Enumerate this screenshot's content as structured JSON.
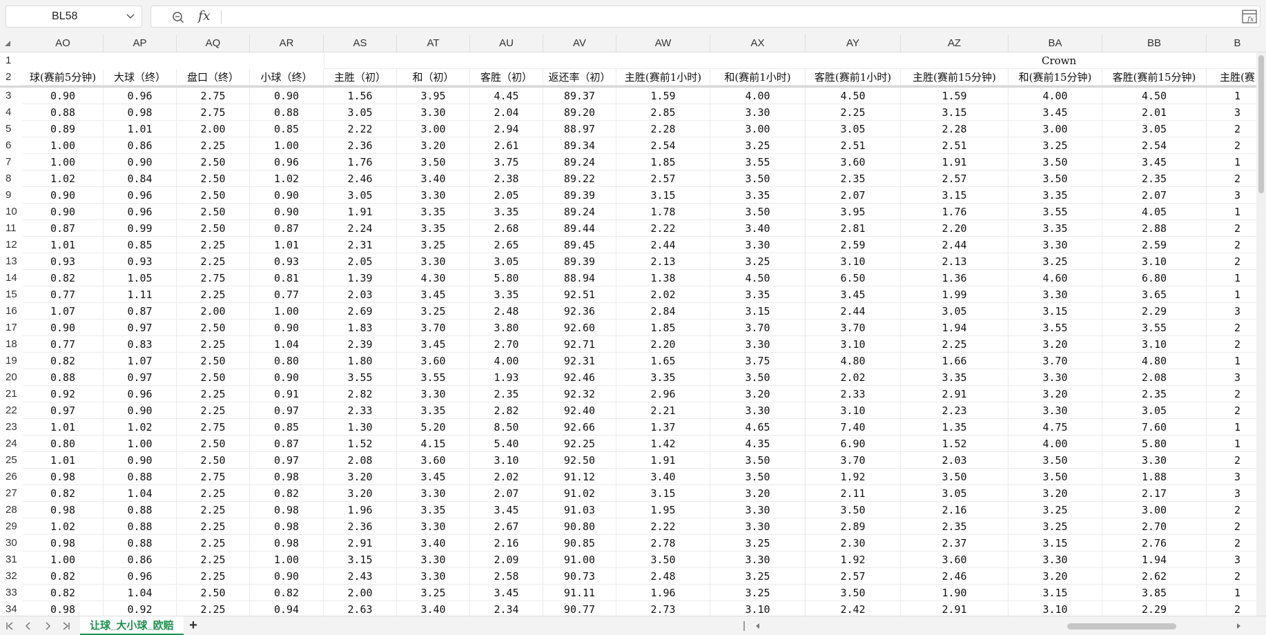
{
  "name_box": "BL58",
  "formula_bar": {
    "fx_label": "fx",
    "value": ""
  },
  "columns": [
    "AO",
    "AP",
    "AQ",
    "AR",
    "AS",
    "AT",
    "AU",
    "AV",
    "AW",
    "AX",
    "AY",
    "AZ",
    "BA",
    "BB",
    "B"
  ],
  "group_label": "Crown",
  "header_labels": [
    "球(赛前5分钟)",
    "大球（终）",
    "盘口（终）",
    "小球（终）",
    "主胜（初）",
    "和（初）",
    "客胜（初）",
    "返还率（初）",
    "主胜(赛前1小时)",
    "和(赛前1小时)",
    "客胜(赛前1小时)",
    "主胜(赛前15分钟)",
    "和(赛前15分钟)",
    "客胜(赛前15分钟)",
    "主胜(赛"
  ],
  "row_numbers": [
    "1",
    "2",
    "3",
    "4",
    "5",
    "6",
    "7",
    "8",
    "9",
    "10",
    "11",
    "12",
    "13",
    "14",
    "15",
    "16",
    "17",
    "18",
    "19",
    "20",
    "21",
    "22",
    "23",
    "24",
    "25",
    "26",
    "27",
    "28",
    "29",
    "30",
    "31",
    "32",
    "33",
    "34"
  ],
  "rows": [
    [
      "0.90",
      "0.96",
      "2.75",
      "0.90",
      "1.56",
      "3.95",
      "4.45",
      "89.37",
      "1.59",
      "4.00",
      "4.50",
      "1.59",
      "4.00",
      "4.50",
      "1"
    ],
    [
      "0.88",
      "0.98",
      "2.75",
      "0.88",
      "3.05",
      "3.30",
      "2.04",
      "89.20",
      "2.85",
      "3.30",
      "2.25",
      "3.15",
      "3.45",
      "2.01",
      "3"
    ],
    [
      "0.89",
      "1.01",
      "2.00",
      "0.85",
      "2.22",
      "3.00",
      "2.94",
      "88.97",
      "2.28",
      "3.00",
      "3.05",
      "2.28",
      "3.00",
      "3.05",
      "2"
    ],
    [
      "1.00",
      "0.86",
      "2.25",
      "1.00",
      "2.36",
      "3.20",
      "2.61",
      "89.34",
      "2.54",
      "3.25",
      "2.51",
      "2.51",
      "3.25",
      "2.54",
      "2"
    ],
    [
      "1.00",
      "0.90",
      "2.50",
      "0.96",
      "1.76",
      "3.50",
      "3.75",
      "89.24",
      "1.85",
      "3.55",
      "3.60",
      "1.91",
      "3.50",
      "3.45",
      "1"
    ],
    [
      "1.02",
      "0.84",
      "2.50",
      "1.02",
      "2.46",
      "3.40",
      "2.38",
      "89.22",
      "2.57",
      "3.50",
      "2.35",
      "2.57",
      "3.50",
      "2.35",
      "2"
    ],
    [
      "0.90",
      "0.96",
      "2.50",
      "0.90",
      "3.05",
      "3.30",
      "2.05",
      "89.39",
      "3.15",
      "3.35",
      "2.07",
      "3.15",
      "3.35",
      "2.07",
      "3"
    ],
    [
      "0.90",
      "0.96",
      "2.50",
      "0.90",
      "1.91",
      "3.35",
      "3.35",
      "89.24",
      "1.78",
      "3.50",
      "3.95",
      "1.76",
      "3.55",
      "4.05",
      "1"
    ],
    [
      "0.87",
      "0.99",
      "2.50",
      "0.87",
      "2.24",
      "3.35",
      "2.68",
      "89.44",
      "2.22",
      "3.40",
      "2.81",
      "2.20",
      "3.35",
      "2.88",
      "2"
    ],
    [
      "1.01",
      "0.85",
      "2.25",
      "1.01",
      "2.31",
      "3.25",
      "2.65",
      "89.45",
      "2.44",
      "3.30",
      "2.59",
      "2.44",
      "3.30",
      "2.59",
      "2"
    ],
    [
      "0.93",
      "0.93",
      "2.25",
      "0.93",
      "2.05",
      "3.30",
      "3.05",
      "89.39",
      "2.13",
      "3.25",
      "3.10",
      "2.13",
      "3.25",
      "3.10",
      "2"
    ],
    [
      "0.82",
      "1.05",
      "2.75",
      "0.81",
      "1.39",
      "4.30",
      "5.80",
      "88.94",
      "1.38",
      "4.50",
      "6.50",
      "1.36",
      "4.60",
      "6.80",
      "1"
    ],
    [
      "0.77",
      "1.11",
      "2.25",
      "0.77",
      "2.03",
      "3.45",
      "3.35",
      "92.51",
      "2.02",
      "3.35",
      "3.45",
      "1.99",
      "3.30",
      "3.65",
      "1"
    ],
    [
      "1.07",
      "0.87",
      "2.00",
      "1.00",
      "2.69",
      "3.25",
      "2.48",
      "92.36",
      "2.84",
      "3.15",
      "2.44",
      "3.05",
      "3.15",
      "2.29",
      "3"
    ],
    [
      "0.90",
      "0.97",
      "2.50",
      "0.90",
      "1.83",
      "3.70",
      "3.80",
      "92.60",
      "1.85",
      "3.70",
      "3.70",
      "1.94",
      "3.55",
      "3.55",
      "2"
    ],
    [
      "0.77",
      "0.83",
      "2.25",
      "1.04",
      "2.39",
      "3.45",
      "2.70",
      "92.71",
      "2.20",
      "3.30",
      "3.10",
      "2.25",
      "3.20",
      "3.10",
      "2"
    ],
    [
      "0.82",
      "1.07",
      "2.50",
      "0.80",
      "1.80",
      "3.60",
      "4.00",
      "92.31",
      "1.65",
      "3.75",
      "4.80",
      "1.66",
      "3.70",
      "4.80",
      "1"
    ],
    [
      "0.88",
      "0.97",
      "2.50",
      "0.90",
      "3.55",
      "3.55",
      "1.93",
      "92.46",
      "3.35",
      "3.50",
      "2.02",
      "3.35",
      "3.30",
      "2.08",
      "3"
    ],
    [
      "0.92",
      "0.96",
      "2.25",
      "0.91",
      "2.82",
      "3.30",
      "2.35",
      "92.32",
      "2.96",
      "3.20",
      "2.33",
      "2.91",
      "3.20",
      "2.35",
      "2"
    ],
    [
      "0.97",
      "0.90",
      "2.25",
      "0.97",
      "2.33",
      "3.35",
      "2.82",
      "92.40",
      "2.21",
      "3.30",
      "3.10",
      "2.23",
      "3.30",
      "3.05",
      "2"
    ],
    [
      "1.01",
      "1.02",
      "2.75",
      "0.85",
      "1.30",
      "5.20",
      "8.50",
      "92.66",
      "1.37",
      "4.65",
      "7.40",
      "1.35",
      "4.75",
      "7.60",
      "1"
    ],
    [
      "0.80",
      "1.00",
      "2.50",
      "0.87",
      "1.52",
      "4.15",
      "5.40",
      "92.25",
      "1.42",
      "4.35",
      "6.90",
      "1.52",
      "4.00",
      "5.80",
      "1"
    ],
    [
      "1.01",
      "0.90",
      "2.50",
      "0.97",
      "2.08",
      "3.60",
      "3.10",
      "92.50",
      "1.91",
      "3.50",
      "3.70",
      "2.03",
      "3.50",
      "3.30",
      "2"
    ],
    [
      "0.98",
      "0.88",
      "2.75",
      "0.98",
      "3.20",
      "3.45",
      "2.02",
      "91.12",
      "3.40",
      "3.50",
      "1.92",
      "3.50",
      "3.50",
      "1.88",
      "3"
    ],
    [
      "0.82",
      "1.04",
      "2.25",
      "0.82",
      "3.20",
      "3.30",
      "2.07",
      "91.02",
      "3.15",
      "3.20",
      "2.11",
      "3.05",
      "3.20",
      "2.17",
      "3"
    ],
    [
      "0.98",
      "0.88",
      "2.25",
      "0.98",
      "1.96",
      "3.35",
      "3.45",
      "91.03",
      "1.95",
      "3.30",
      "3.50",
      "2.16",
      "3.25",
      "3.00",
      "2"
    ],
    [
      "1.02",
      "0.88",
      "2.25",
      "0.98",
      "2.36",
      "3.30",
      "2.67",
      "90.80",
      "2.22",
      "3.30",
      "2.89",
      "2.35",
      "3.25",
      "2.70",
      "2"
    ],
    [
      "0.98",
      "0.88",
      "2.25",
      "0.98",
      "2.91",
      "3.40",
      "2.16",
      "90.85",
      "2.78",
      "3.25",
      "2.30",
      "2.37",
      "3.15",
      "2.76",
      "2"
    ],
    [
      "1.00",
      "0.86",
      "2.25",
      "1.00",
      "3.15",
      "3.30",
      "2.09",
      "91.00",
      "3.50",
      "3.30",
      "1.92",
      "3.60",
      "3.30",
      "1.94",
      "3"
    ],
    [
      "0.82",
      "0.96",
      "2.25",
      "0.90",
      "2.43",
      "3.30",
      "2.58",
      "90.73",
      "2.48",
      "3.25",
      "2.57",
      "2.46",
      "3.20",
      "2.62",
      "2"
    ],
    [
      "0.82",
      "1.04",
      "2.50",
      "0.82",
      "2.00",
      "3.25",
      "3.45",
      "91.11",
      "1.96",
      "3.25",
      "3.50",
      "1.90",
      "3.15",
      "3.85",
      "1"
    ],
    [
      "0.98",
      "0.92",
      "2.25",
      "0.94",
      "2.63",
      "3.40",
      "2.34",
      "90.77",
      "2.73",
      "3.10",
      "2.42",
      "2.91",
      "3.10",
      "2.29",
      "2"
    ]
  ],
  "sheet_tab": "让球_大小球_欧赔",
  "add_sheet": "+"
}
